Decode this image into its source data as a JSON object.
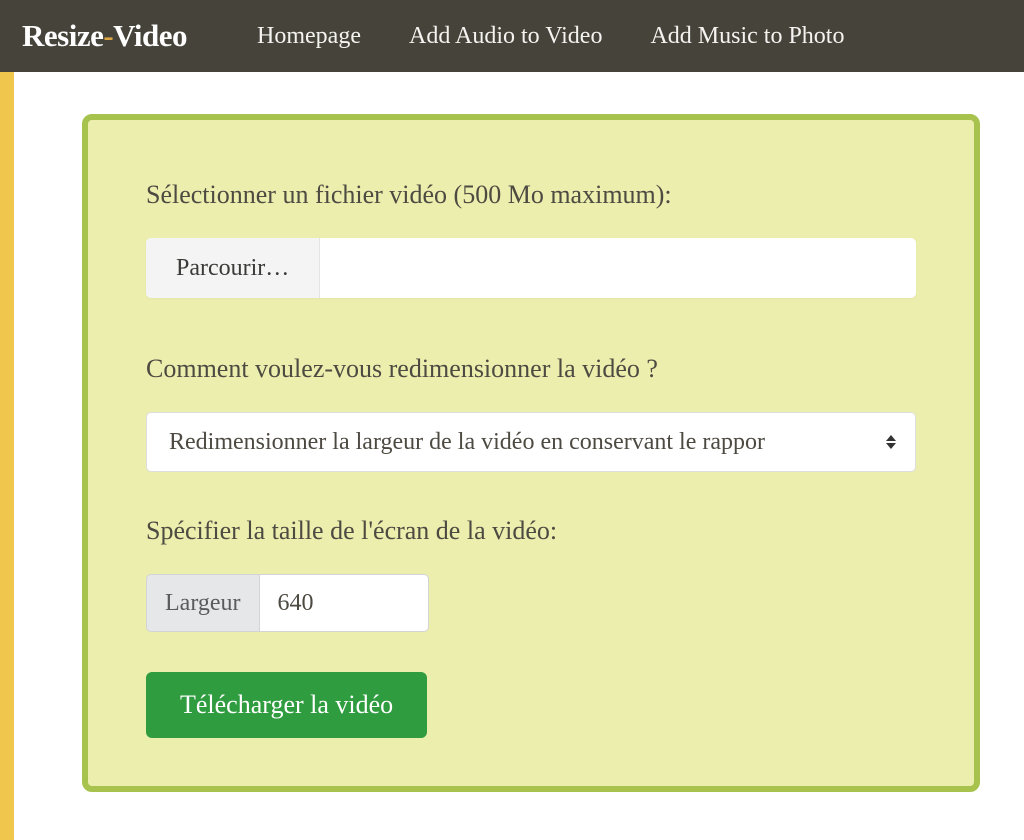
{
  "brand": {
    "part1": "Resize",
    "dash": "-",
    "part2": "Video"
  },
  "nav": {
    "homepage": "Homepage",
    "add_audio": "Add Audio to Video",
    "add_music": "Add Music to Photo"
  },
  "form": {
    "select_file_label": "Sélectionner un fichier vidéo (500 Mo maximum):",
    "browse_label": "Parcourir…",
    "resize_question": "Comment voulez-vous redimensionner la vidéo ?",
    "resize_selected": "Redimensionner la largeur de la vidéo en conservant le rappor",
    "specify_size_label": "Spécifier la taille de l'écran de la vidéo:",
    "width_addon": "Largeur",
    "width_value": "640",
    "submit_label": "Télécharger la vidéo"
  }
}
